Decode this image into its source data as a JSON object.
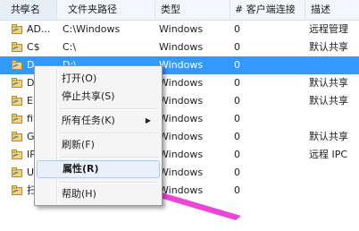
{
  "columns": [
    "共享名",
    "文件夹路径",
    "类型",
    "# 客户端连接",
    "描述"
  ],
  "rows": [
    {
      "name": "AD...",
      "path": "C:\\Windows",
      "type": "Windows",
      "clients": "0",
      "desc": "远程管理"
    },
    {
      "name": "C$",
      "path": "C:\\",
      "type": "Windows",
      "clients": "0",
      "desc": "默认共享"
    },
    {
      "name": "D",
      "path": "D:\\",
      "type": "Windows",
      "clients": "0",
      "desc": ""
    },
    {
      "name": "D",
      "path": "",
      "type": "Windows",
      "clients": "0",
      "desc": "默认共享"
    },
    {
      "name": "E",
      "path": "",
      "type": "Windows",
      "clients": "0",
      "desc": "默认共享"
    },
    {
      "name": "fi",
      "path": "",
      "type": "Windows",
      "clients": "0",
      "desc": ""
    },
    {
      "name": "G",
      "path": "",
      "type": "Windows",
      "clients": "0",
      "desc": "默认共享"
    },
    {
      "name": "IP",
      "path": "",
      "type": "Windows",
      "clients": "0",
      "desc": "远程 IPC"
    },
    {
      "name": "U",
      "path": "",
      "type": "Windows",
      "clients": "0",
      "desc": ""
    },
    {
      "name": "扫",
      "path": "",
      "type": "Windows",
      "clients": "0",
      "desc": ""
    }
  ],
  "selected_row": 2,
  "context_menu": {
    "open": "打开(O)",
    "stop_share": "停止共享(S)",
    "all_tasks": "所有任务(K)",
    "refresh": "刷新(F)",
    "properties": "属性(R)",
    "help": "帮助(H)"
  },
  "colors": {
    "selection": "#3399ff",
    "annotation_arrow": "#e833d4"
  }
}
